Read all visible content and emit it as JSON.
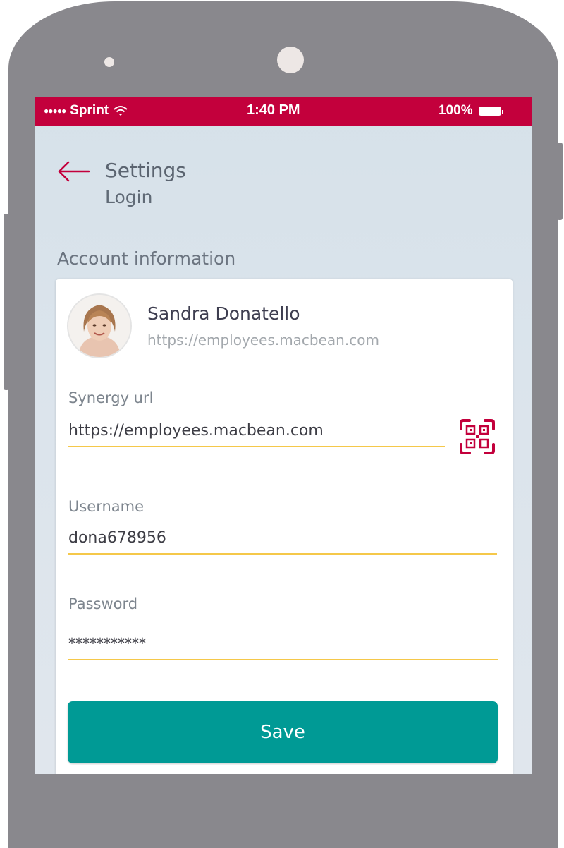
{
  "status_bar": {
    "signal_dots": "●●●●●",
    "carrier": "Sprint",
    "time": "1:40 PM",
    "battery": "100%"
  },
  "header": {
    "back_icon": "arrow-left-icon",
    "title": "Settings",
    "subtitle": "Login"
  },
  "section": {
    "label": "Account information"
  },
  "profile": {
    "name": "Sandra Donatello",
    "url": "https://employees.macbean.com"
  },
  "fields": {
    "synergy_url": {
      "label": "Synergy url",
      "value": "https://employees.macbean.com",
      "icon": "qr-code-icon"
    },
    "username": {
      "label": "Username",
      "value": "dona678956"
    },
    "password": {
      "label": "Password",
      "value": "***********"
    }
  },
  "save_label": "Save",
  "colors": {
    "status_bar": "#c3003c",
    "accent": "#c3003c",
    "underline": "#f5c84a",
    "save_button": "#009a95",
    "device": "#89888d"
  }
}
